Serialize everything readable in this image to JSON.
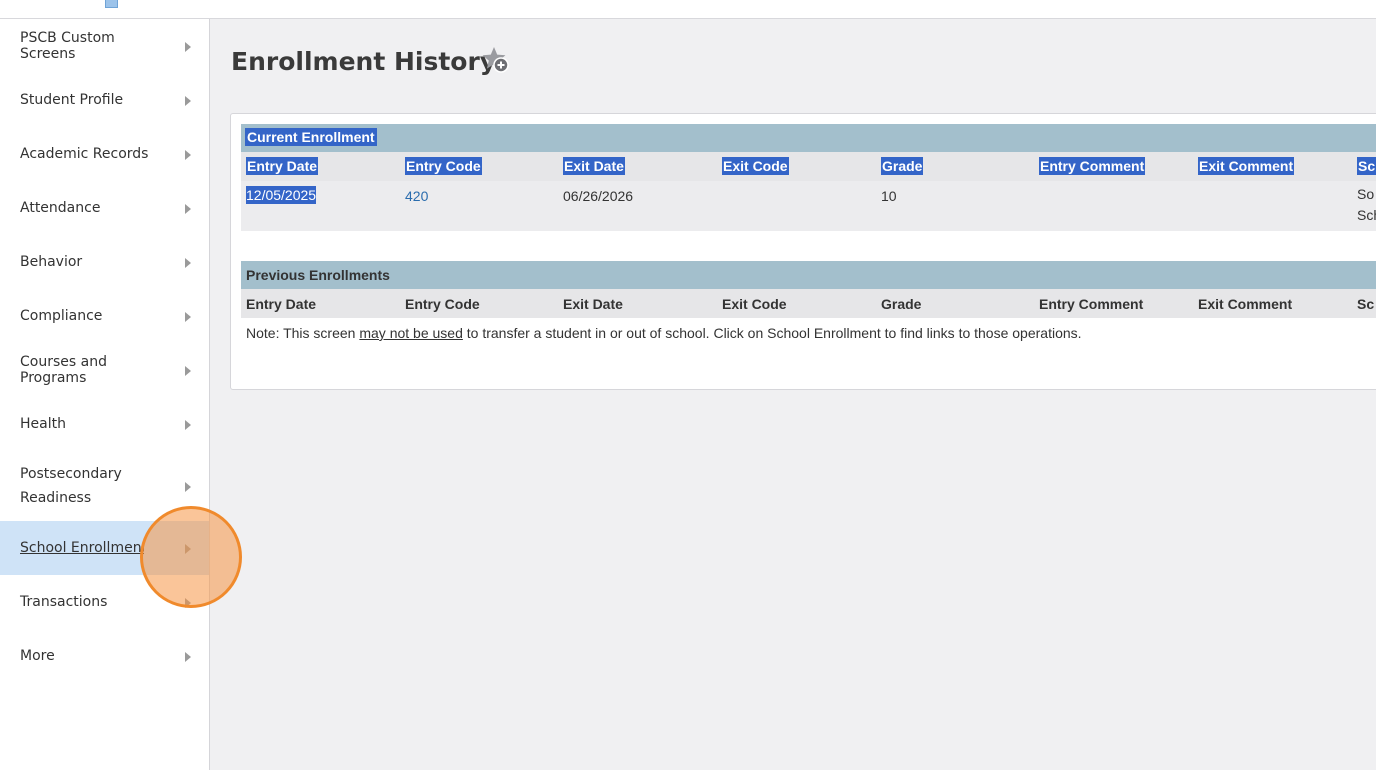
{
  "sidebar": {
    "items": [
      {
        "label": "PSCB Custom Screens"
      },
      {
        "label": "Student Profile"
      },
      {
        "label": "Academic Records"
      },
      {
        "label": "Attendance"
      },
      {
        "label": "Behavior"
      },
      {
        "label": "Compliance"
      },
      {
        "label": "Courses and Programs"
      },
      {
        "label": "Health"
      },
      {
        "label": "Postsecondary Readiness"
      },
      {
        "label": "School Enrollment"
      },
      {
        "label": "Transactions"
      },
      {
        "label": "More"
      }
    ],
    "active_index": 9
  },
  "page": {
    "title": "Enrollment History",
    "favorite_icon": "star-add-icon"
  },
  "current": {
    "header": "Current Enrollment",
    "columns": [
      "Entry Date",
      "Entry Code",
      "Exit Date",
      "Exit Code",
      "Grade",
      "Entry Comment",
      "Exit Comment",
      "Sc"
    ],
    "row": {
      "entry_date": "12/05/2025",
      "entry_code": "420",
      "exit_date": "06/26/2026",
      "exit_code": "",
      "grade": "10",
      "entry_comment": "",
      "exit_comment": "",
      "school_line1": "So",
      "school_line2": "Sch"
    }
  },
  "previous": {
    "header": "Previous Enrollments",
    "columns": [
      "Entry Date",
      "Entry Code",
      "Exit Date",
      "Exit Code",
      "Grade",
      "Entry Comment",
      "Exit Comment",
      "Sc"
    ]
  },
  "note": {
    "prefix": "Note: This screen ",
    "emphasis": "may not be used",
    "suffix": " to transfer a student in or out of school. Click on School Enrollment to find links to those operations."
  },
  "colors": {
    "section_header": "#a3bfcc",
    "selection": "#3465c8",
    "active_nav": "#cfe3f7",
    "link": "#2a6cad",
    "click_indicator": "#f08a2c"
  }
}
